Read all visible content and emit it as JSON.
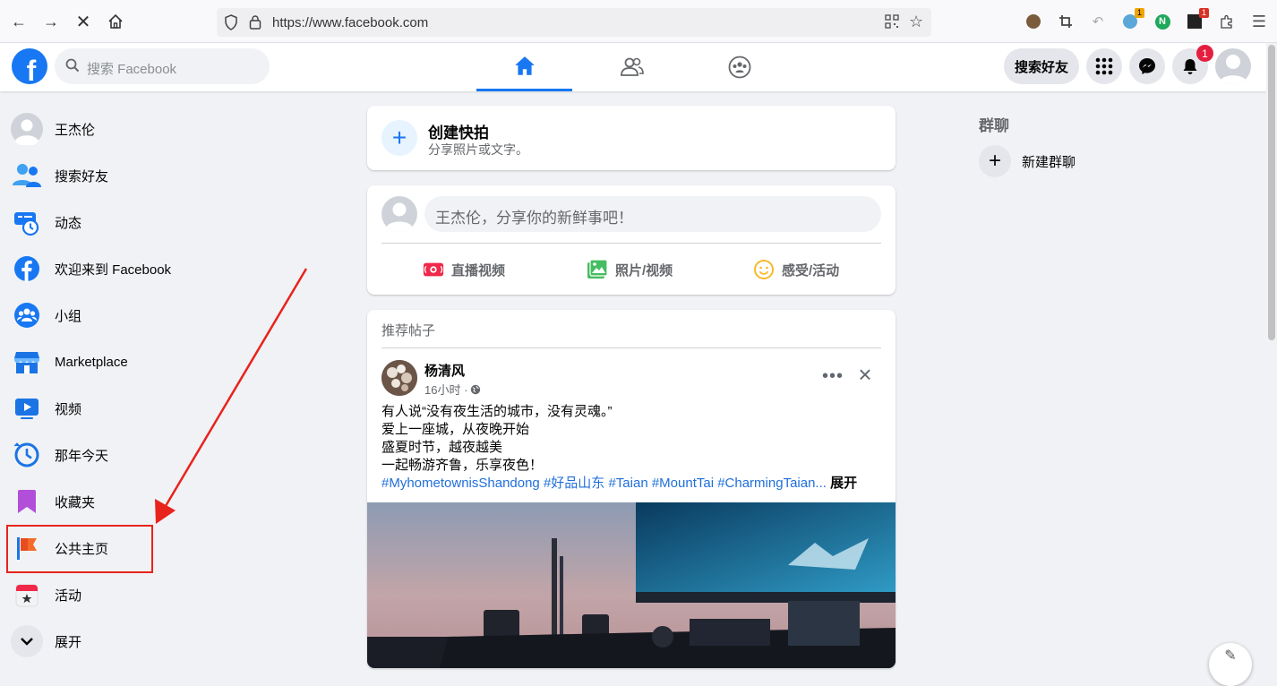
{
  "browser": {
    "url": "https://www.facebook.com",
    "ext_badge_1": "1",
    "ext_badge_2": "1"
  },
  "header": {
    "logo": "f",
    "search_placeholder": "搜索 Facebook",
    "find_friends": "搜索好友",
    "notification_count": "1"
  },
  "sidebar": {
    "items": [
      {
        "label": "王杰伦",
        "icon": "profile-avatar"
      },
      {
        "label": "搜索好友",
        "icon": "friends-icon"
      },
      {
        "label": "动态",
        "icon": "memories-feed-icon"
      },
      {
        "label": "欢迎来到 Facebook",
        "icon": "facebook-icon"
      },
      {
        "label": "小组",
        "icon": "groups-icon"
      },
      {
        "label": "Marketplace",
        "icon": "marketplace-icon"
      },
      {
        "label": "视频",
        "icon": "video-icon"
      },
      {
        "label": "那年今天",
        "icon": "clock-icon"
      },
      {
        "label": "收藏夹",
        "icon": "bookmark-icon"
      },
      {
        "label": "公共主页",
        "icon": "flag-icon"
      },
      {
        "label": "活动",
        "icon": "calendar-icon"
      },
      {
        "label": "展开",
        "icon": "chevron-down-icon"
      }
    ]
  },
  "story": {
    "title": "创建快拍",
    "subtitle": "分享照片或文字。"
  },
  "composer": {
    "placeholder": "王杰伦，分享你的新鲜事吧！",
    "actions": [
      "直播视频",
      "照片/视频",
      "感受/活动"
    ]
  },
  "post": {
    "section_label": "推荐帖子",
    "author": "杨清风",
    "time": "16小时 ·",
    "lines": [
      "有人说“没有夜生活的城市，没有灵魂。”",
      "爱上一座城，从夜晚开始",
      "盛夏时节，越夜越美",
      "一起畅游齐鲁，乐享夜色！"
    ],
    "hashtags": "#MyhometownisShandong #好品山东 #Taian #MountTai  #CharmingTaian...",
    "expand": "展开"
  },
  "right": {
    "group_chat_title": "群聊",
    "new_group": "新建群聊"
  },
  "colors": {
    "brand": "#1877f2",
    "highlight": "#e8231c"
  }
}
